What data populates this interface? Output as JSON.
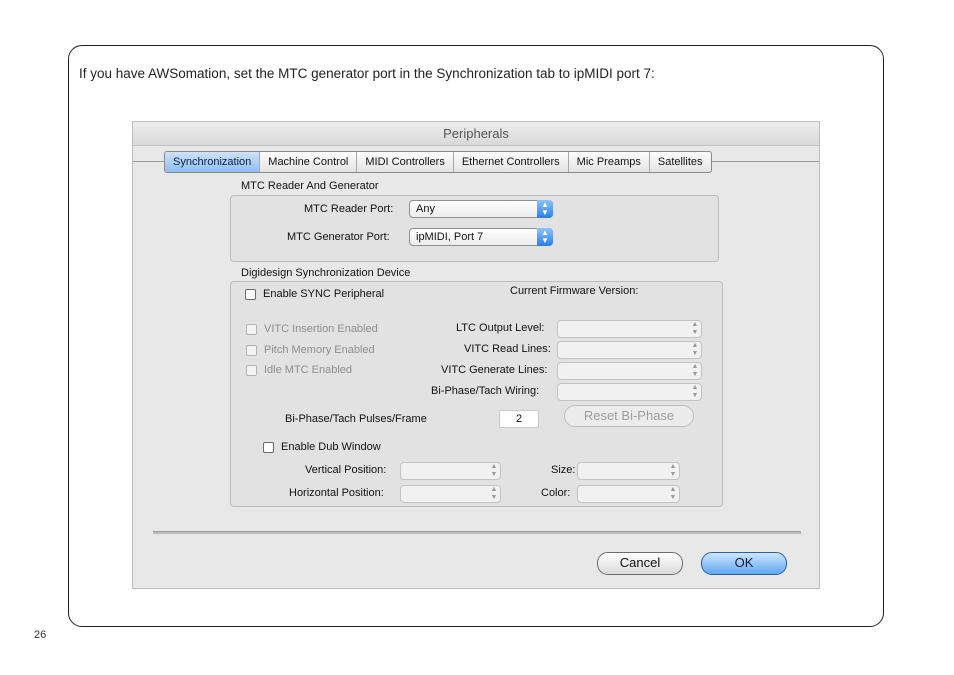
{
  "intro_text": "If you have AWSomation, set the MTC generator port in the Synchronization tab to ipMIDI port 7:",
  "page_number": "26",
  "window": {
    "title": "Peripherals",
    "tabs": [
      "Synchronization",
      "Machine Control",
      "MIDI Controllers",
      "Ethernet Controllers",
      "Mic Preamps",
      "Satellites"
    ],
    "active_tab": "Synchronization"
  },
  "mtc": {
    "group_label": "MTC Reader And Generator",
    "reader_label": "MTC Reader Port:",
    "reader_value": "Any",
    "generator_label": "MTC Generator Port:",
    "generator_value": "ipMIDI, Port 7"
  },
  "sync_device": {
    "group_label": "Digidesign Synchronization Device",
    "enable_sync": "Enable SYNC Peripheral",
    "firmware_label": "Current Firmware Version:",
    "vitc_insertion": "VITC Insertion Enabled",
    "pitch_memory": "Pitch Memory Enabled",
    "idle_mtc": "Idle MTC Enabled",
    "ltc_output": "LTC Output Level:",
    "vitc_read": "VITC Read Lines:",
    "vitc_generate": "VITC Generate Lines:",
    "biphase_wiring": "Bi-Phase/Tach Wiring:",
    "pulses_label": "Bi-Phase/Tach Pulses/Frame",
    "pulses_value": "2",
    "reset_button": "Reset Bi-Phase",
    "dub_window": "Enable Dub Window",
    "vertical_position": "Vertical Position:",
    "horizontal_position": "Horizontal Position:",
    "size": "Size:",
    "color": "Color:"
  },
  "buttons": {
    "cancel": "Cancel",
    "ok": "OK"
  }
}
